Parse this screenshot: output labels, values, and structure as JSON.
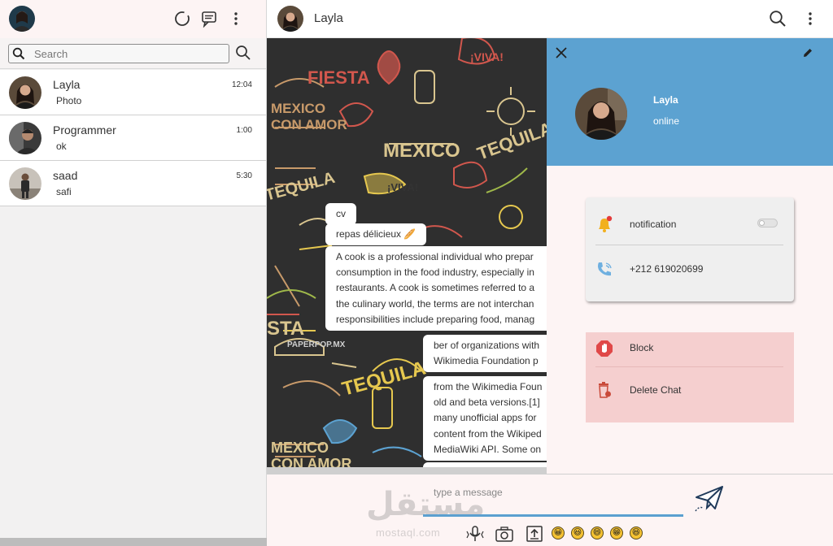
{
  "sidebar": {
    "search": {
      "placeholder": "Search"
    },
    "chats": [
      {
        "name": "Layla",
        "last_message": "Photo",
        "time": "12:04"
      },
      {
        "name": "Programmer",
        "last_message": "ok",
        "time": "1:00"
      },
      {
        "name": "saad",
        "last_message": "safi",
        "time": "5:30"
      }
    ]
  },
  "conversation": {
    "title": "Layla",
    "messages": [
      {
        "lines": [
          "cv"
        ]
      },
      {
        "lines": [
          "repas délicieux 🥖"
        ]
      },
      {
        "lines": [
          "A cook is a professional individual who prepar",
          "consumption in the food industry, especially in",
          "restaurants. A cook is sometimes referred to a",
          "the culinary world, the terms are not interchan",
          "responsibilities include preparing food, manag"
        ]
      },
      {
        "lines": [
          "ber of organizations with",
          "Wikimedia Foundation p"
        ]
      },
      {
        "lines": [
          "from the Wikimedia Foun",
          "old and beta versions.[1]",
          "many unofficial apps for",
          "content from the Wikiped",
          "MediaWiki API. Some on"
        ]
      },
      {
        "lines": [
          ""
        ]
      }
    ],
    "composer": {
      "placeholder": "type a message"
    },
    "watermark": {
      "arabic": "مستقل",
      "latin": "mostaql.com"
    },
    "emojis": [
      "😀",
      "😃",
      "😄",
      "😁",
      "😆"
    ]
  },
  "contact_panel": {
    "name": "Layla",
    "status": "online",
    "notification_label": "notification",
    "notifications_enabled": false,
    "phone": "+212 619020699",
    "block_label": "Block",
    "delete_label": "Delete Chat"
  },
  "colors": {
    "accent": "#5ca2d1",
    "panel_bg": "#fdf4f4",
    "danger_bg": "#f5cfcf",
    "chat_bg": "#2f2f2f"
  },
  "icons": {
    "sidebar_header": [
      "status-icon",
      "new-chat-icon",
      "menu-icon"
    ],
    "chat_header": [
      "search-icon",
      "menu-icon"
    ],
    "composer_tools": [
      "microphone-icon",
      "camera-icon",
      "upload-icon",
      "send-icon"
    ],
    "panel": [
      "close-icon",
      "edit-icon",
      "bell-icon",
      "phone-icon",
      "block-icon",
      "trash-icon"
    ]
  }
}
